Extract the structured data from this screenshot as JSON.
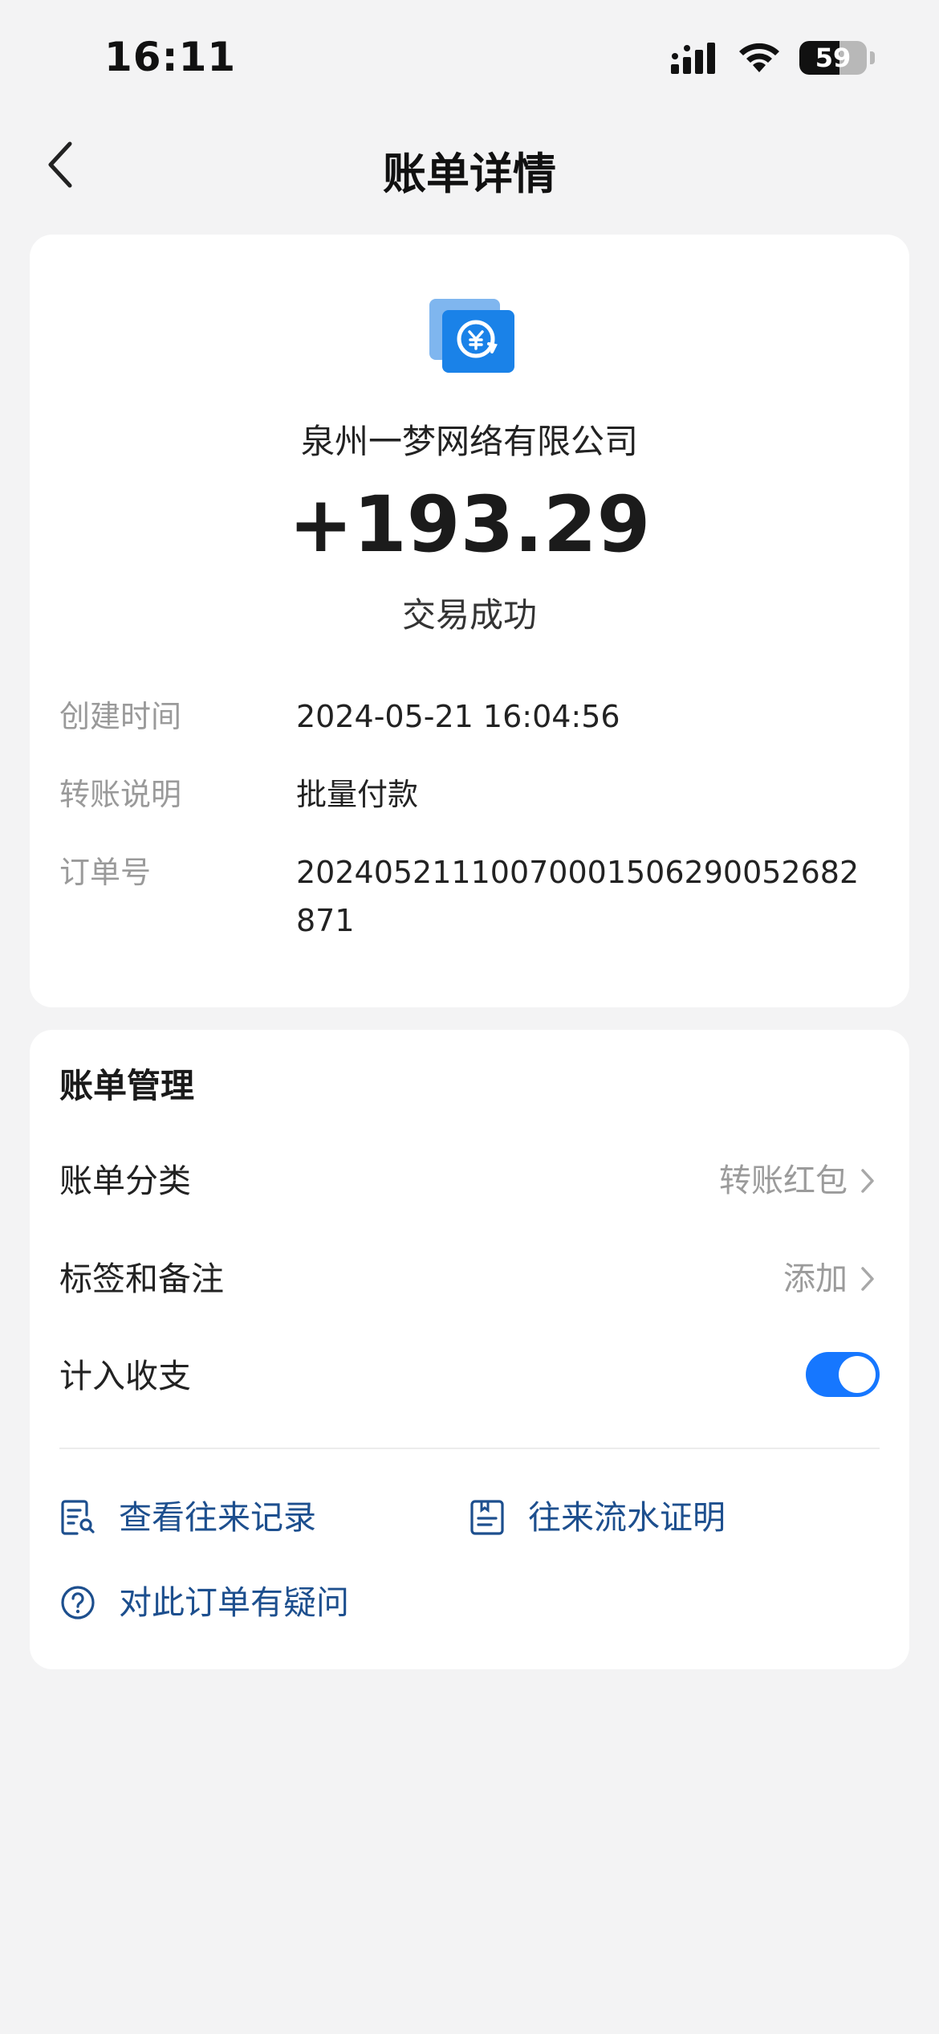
{
  "status_bar": {
    "time": "16:11",
    "battery": "59",
    "battery_level": 0.59
  },
  "nav": {
    "title": "账单详情"
  },
  "summary": {
    "payee": "泉州一梦网络有限公司",
    "amount": "+193.29",
    "status": "交易成功"
  },
  "details": [
    {
      "label": "创建时间",
      "value": "2024-05-21 16:04:56"
    },
    {
      "label": "转账说明",
      "value": "批量付款"
    },
    {
      "label": "订单号",
      "value": "20240521110070001506290052682871"
    }
  ],
  "manage": {
    "title": "账单管理",
    "category": {
      "label": "账单分类",
      "value": "转账红包"
    },
    "tags": {
      "label": "标签和备注",
      "value": "添加"
    },
    "include": {
      "label": "计入收支",
      "on": true
    }
  },
  "actions": {
    "view_records": "查看往来记录",
    "statement": "往来流水证明",
    "question": "对此订单有疑问"
  },
  "colors": {
    "accent": "#1677ff",
    "link": "#1d4f8e",
    "background": "#f3f3f4"
  }
}
